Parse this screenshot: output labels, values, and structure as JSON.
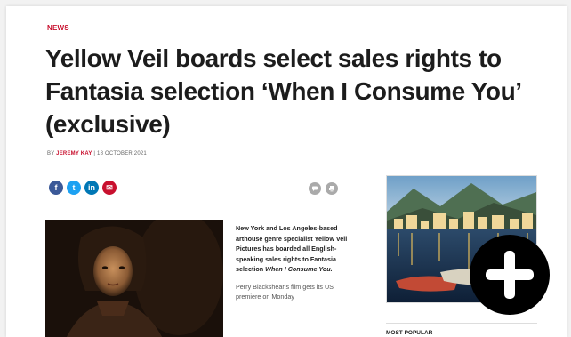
{
  "article": {
    "section": "NEWS",
    "headline": "Yellow Veil boards select sales rights to Fantasia selection ‘When I Consume You’ (exclusive)",
    "byline_prefix": "BY ",
    "author": "JEREMY KAY",
    "byline_separator": " | ",
    "date": "18 OCTOBER 2021",
    "lead_before_title": "New York and Los Angeles-based arthouse genre specialist Yellow Veil Pictures has boarded all English-speaking sales rights to Fantasia selection ",
    "lead_title": "When I Consume You.",
    "para2": "Perry Blackshear’s film gets its US premiere on Monday"
  },
  "share": [
    {
      "name": "facebook-icon",
      "glyph": "f",
      "color": "#3b5998"
    },
    {
      "name": "twitter-icon",
      "glyph": "t",
      "color": "#1da1f2"
    },
    {
      "name": "linkedin-icon",
      "glyph": "in",
      "color": "#0077b5"
    },
    {
      "name": "email-icon",
      "glyph": "✉",
      "color": "#c8102e"
    }
  ],
  "tools": [
    "comment-icon",
    "print-icon"
  ],
  "sidebar": {
    "most_popular_label": "MOST POPULAR"
  },
  "overlay": {
    "icon": "plus-icon"
  }
}
